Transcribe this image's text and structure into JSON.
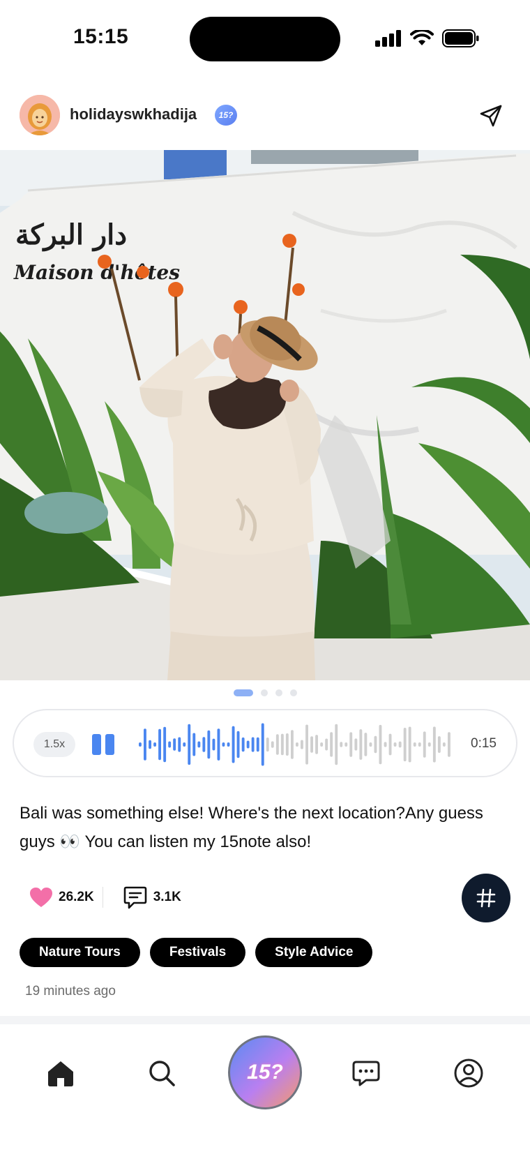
{
  "status_bar": {
    "time": "15:15"
  },
  "post": {
    "username": "holidayswkhadija",
    "verified_badge_label": "15?",
    "image_sign_text": "دار البركة Maison d'hôtes",
    "carousel": {
      "total": 4,
      "active_index": 0
    },
    "audio": {
      "speed_label": "1.5x",
      "duration": "0:15",
      "state": "playing",
      "progress": 0.4
    },
    "caption": "Bali was something else! Where's the next location?Any guess guys 👀 You can listen my 15note also!",
    "likes": "26.2K",
    "comments": "3.1K",
    "tags": [
      "Nature Tours",
      "Festivals",
      "Style Advice"
    ],
    "timestamp": "19 minutes ago"
  },
  "bottom_nav": {
    "items": [
      "home",
      "search",
      "create",
      "messages",
      "profile"
    ],
    "center_label": "15?",
    "active": "home"
  },
  "colors": {
    "accent": "#4a86f0",
    "like": "#f36fa8",
    "hash_button": "#0f1b2d",
    "tag_bg": "#000000"
  },
  "icons": {
    "share": "paper-plane-icon",
    "like": "heart-icon",
    "comment": "comment-icon",
    "hashtag": "hashtag-icon",
    "home": "home-icon",
    "search": "search-icon",
    "messages": "chat-bubble-icon",
    "profile": "profile-icon"
  }
}
